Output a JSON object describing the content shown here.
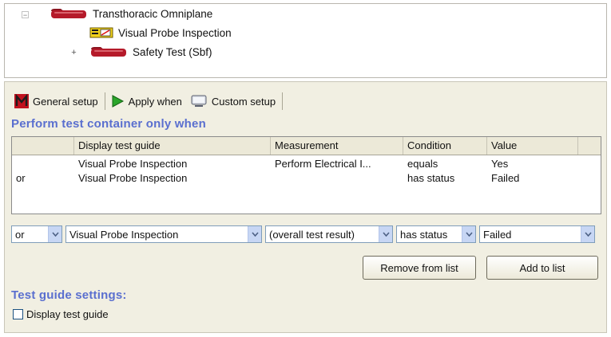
{
  "tree": {
    "items": [
      {
        "label": "Transthoracic Omniplane",
        "expander": "−"
      },
      {
        "label": "Visual Probe Inspection"
      },
      {
        "label": "Safety Test (Sbf)",
        "expander": "+"
      }
    ]
  },
  "tabs": [
    {
      "label": "General setup",
      "icon": "m-logo-icon"
    },
    {
      "label": "Apply when",
      "icon": "green-arrow-icon"
    },
    {
      "label": "Custom setup",
      "icon": "monitor-icon"
    }
  ],
  "section_title": "Perform test container only when",
  "grid": {
    "columns": [
      "",
      "Display test guide",
      "Measurement",
      "Condition",
      "Value"
    ],
    "rows": [
      {
        "op": "",
        "guide": "Visual Probe Inspection",
        "measurement": "Perform Electrical I...",
        "condition": "equals",
        "value": "Yes"
      },
      {
        "op": "or",
        "guide": "Visual Probe Inspection",
        "measurement": "",
        "condition": "has status",
        "value": "Failed"
      }
    ]
  },
  "editor": {
    "op": "or",
    "guide": "Visual Probe Inspection",
    "measurement": "(overall test result)",
    "condition": "has status",
    "value": "Failed"
  },
  "buttons": {
    "remove": "Remove from list",
    "add": "Add to list"
  },
  "test_guide": {
    "title": "Test guide settings:",
    "checkbox_label": "Display test guide",
    "checked": false
  },
  "colors": {
    "accent": "#5a6fcf",
    "panel": "#f1efe2",
    "probe": "#b51a2a"
  }
}
